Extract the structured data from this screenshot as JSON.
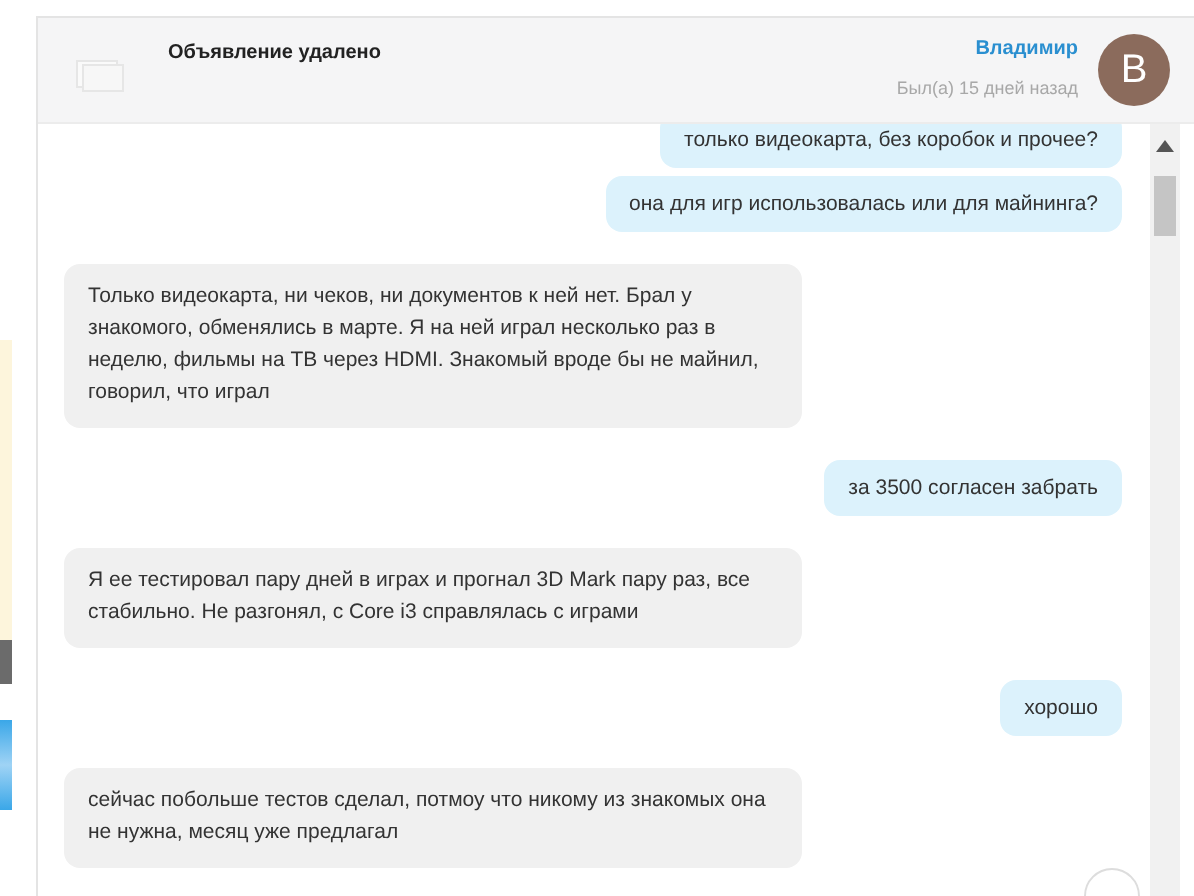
{
  "header": {
    "listing_title": "Объявление удалено",
    "contact_name": "Владимир",
    "last_seen": "Был(а) 15 дней назад",
    "avatar_letter": "В"
  },
  "messages": [
    {
      "kind": "outgoing",
      "text": "только видеокарта, без коробок и прочее?"
    },
    {
      "kind": "outgoing",
      "text": "она для игр использовалась или для майнинга?"
    },
    {
      "kind": "incoming",
      "text": "Только видеокарта, ни чеков, ни документов к ней нет. Брал у знакомого, обменялись в марте. Я на ней играл несколько раз в неделю, фильмы на ТВ через HDMI. Знакомый вроде бы не майнил, говорил, что играл"
    },
    {
      "kind": "outgoing",
      "text": "за 3500 согласен забрать"
    },
    {
      "kind": "incoming",
      "text": "Я ее тестировал пару дней в играх и прогнал 3D Mark пару раз, все стабильно. Не разгонял, с Core i3 справлялась с играми"
    },
    {
      "kind": "outgoing",
      "text": "хорошо"
    },
    {
      "kind": "incoming",
      "text": "сейчас побольше тестов сделал, потмоу что никому из знакомых она не нужна, месяц уже предлагал"
    }
  ]
}
